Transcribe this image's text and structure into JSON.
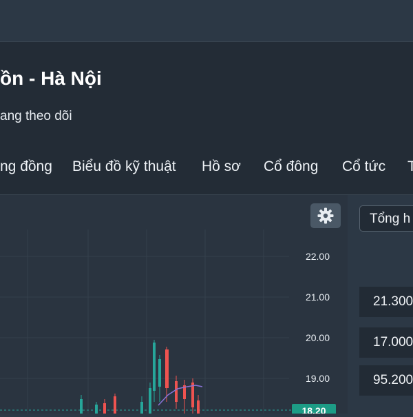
{
  "header": {
    "title": "ồn - Hà Nội",
    "subtitle": "ang theo dõi"
  },
  "tabs": [
    "ng đồng",
    "Biểu đồ kỹ thuật",
    "Hồ sơ",
    "Cổ đông",
    "Cổ tức",
    "T"
  ],
  "toolbar": {
    "settings_icon": "gear-icon",
    "dropdown_label": "Tổng h"
  },
  "chart": {
    "price_axis_labels": [
      "22.00",
      "21.00",
      "20.00",
      "19.00"
    ],
    "current_price": "18.20"
  },
  "side_values": [
    "21.300",
    "17.000",
    "95.200"
  ],
  "colors": {
    "up": "#26a69a",
    "down": "#ef5350",
    "ma_line": "#8a73d6",
    "price_tag": "#1d9c86"
  }
}
